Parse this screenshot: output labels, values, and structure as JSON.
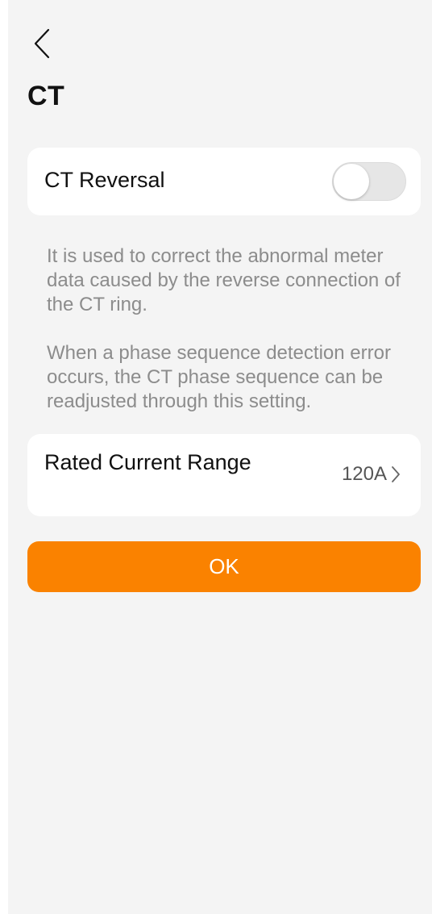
{
  "header": {
    "back_icon": "chevron-left-icon",
    "title": "CT"
  },
  "ct_reversal": {
    "label": "CT Reversal",
    "enabled": false
  },
  "descriptions": [
    "It is used to correct the abnormal meter data caused by the reverse connection of the CT ring.",
    "When a phase sequence detection error occurs, the CT phase sequence can be readjusted through this setting."
  ],
  "rated_current_range": {
    "label": "Rated Current Range",
    "value": "120A",
    "icon": "chevron-right-icon"
  },
  "ok_button": {
    "label": "OK",
    "color": "#fa8200"
  },
  "colors": {
    "background": "#f4f4f4",
    "card": "#ffffff",
    "description_text": "#8c8c8c",
    "toggle_off": "#e6e6e6"
  }
}
